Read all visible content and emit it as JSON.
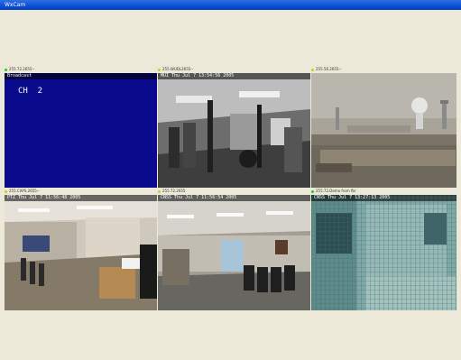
{
  "window": {
    "title": "WxCam"
  },
  "cameras": [
    {
      "header": "255.72.2655--",
      "status_color": "#22cc22",
      "osd": "Broadcast",
      "channel": "CH  2"
    },
    {
      "header": "255.WUDL2655--",
      "status_color": "#cccc22",
      "osd": "MUI   Thu Jul  7 13:54:56 2005"
    },
    {
      "header": "255.56.2655--",
      "status_color": "#cccc22",
      "osd": ""
    },
    {
      "header": "255.CAPS.2655--",
      "status_color": "#cccc22",
      "osd": "PTZ  Thu Jul  7 11:56:48 2005"
    },
    {
      "header": "255.72.2655",
      "status_color": "#cccc22",
      "osd": "CNSS  Thu Jul  7 11:56:54 2005"
    },
    {
      "header": "255.72.Demo from fbr",
      "status_color": "#22cc22",
      "osd": "CNSS  Thu Jul  7 13:27:13 2005"
    }
  ]
}
